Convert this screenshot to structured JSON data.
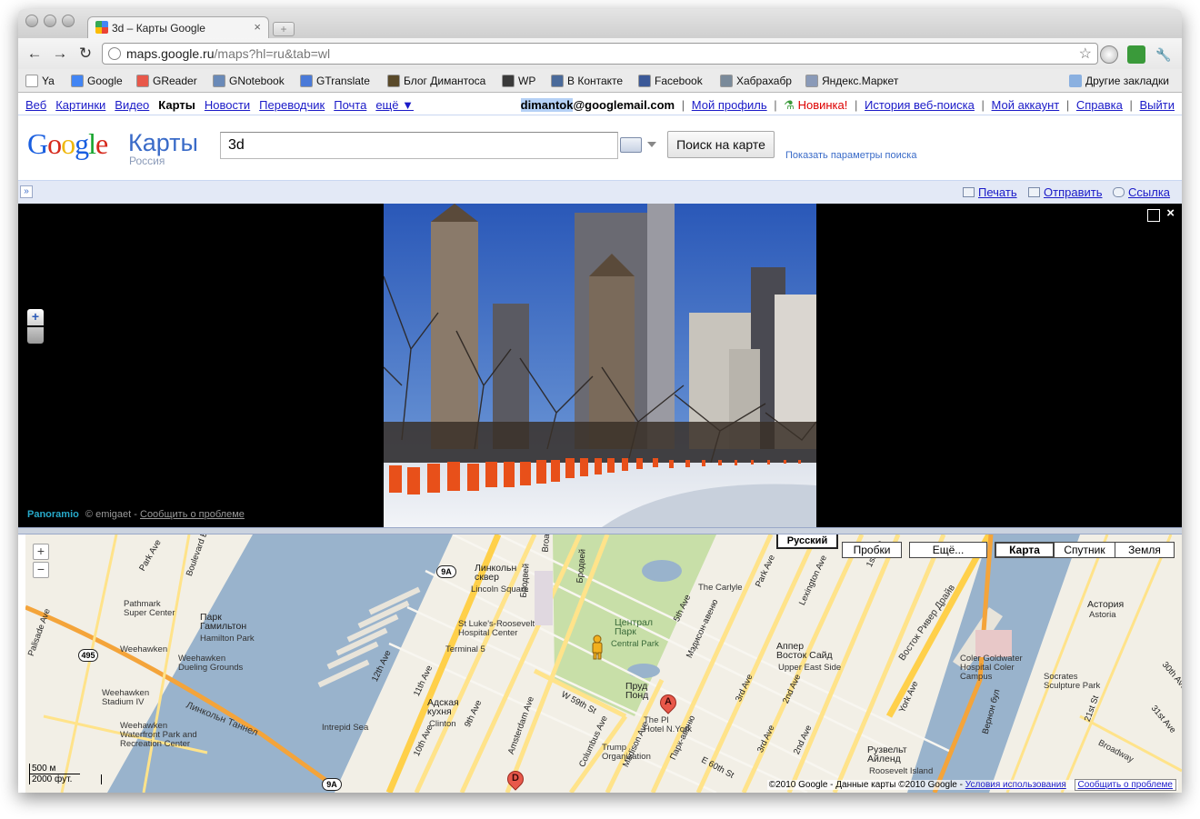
{
  "browser": {
    "tab_title": "3d – Карты Google",
    "tab_close": "×",
    "new_tab": "+",
    "url_host": "maps.google.ru",
    "url_path": "/maps?hl=ru&tab=wl",
    "back": "←",
    "forward": "→",
    "reload": "↻",
    "star": "☆",
    "wrench": "🔧"
  },
  "bookmarks": {
    "items": [
      {
        "label": "Ya",
        "color": "#ffffff"
      },
      {
        "label": "Google",
        "color": "#4285f4"
      },
      {
        "label": "GReader",
        "color": "#e8584a"
      },
      {
        "label": "GNotebook",
        "color": "#6a8ab8"
      },
      {
        "label": "GTranslate",
        "color": "#4a7ad8"
      },
      {
        "label": "Блог Димантоса",
        "color": "#5a4a2a"
      },
      {
        "label": "WP",
        "color": "#3a3a3a"
      },
      {
        "label": "В Контакте",
        "color": "#4a6a9a"
      },
      {
        "label": "Facebook",
        "color": "#3b5998"
      },
      {
        "label": "Хабрахабр",
        "color": "#7a8a9a"
      },
      {
        "label": "Яндекс.Маркет",
        "color": "#8a9ab8"
      }
    ],
    "other": "Другие закладки"
  },
  "gbar": {
    "left": [
      {
        "label": "Веб",
        "bold": false
      },
      {
        "label": "Картинки",
        "bold": false
      },
      {
        "label": "Видео",
        "bold": false
      },
      {
        "label": "Карты",
        "bold": true
      },
      {
        "label": "Новости",
        "bold": false
      },
      {
        "label": "Переводчик",
        "bold": false
      },
      {
        "label": "Почта",
        "bold": false
      },
      {
        "label": "ещё ▼",
        "bold": false
      }
    ],
    "user_highlight": "dimantok",
    "user_rest": "@googlemail.com",
    "profile": "Мой профиль",
    "new_label": "Новинка!",
    "history": "История веб-поиска",
    "account": "Мой аккаунт",
    "help": "Справка",
    "logout": "Выйти",
    "separator": "|"
  },
  "header": {
    "logo_letters": [
      "G",
      "o",
      "o",
      "g",
      "l",
      "e"
    ],
    "logo_maps": "Карты",
    "logo_country": "Россия",
    "search_value": "3d",
    "search_button": "Поиск на карте",
    "search_options": "Показать параметры поиска"
  },
  "actions": {
    "expand": "»",
    "print": "Печать",
    "send": "Отправить",
    "link": "Ссылка"
  },
  "photo": {
    "zoom_in": "+",
    "close": "×",
    "brand": "Panoramio",
    "copyright": "© emigaet -",
    "report": "Сообщить о проблеме"
  },
  "map": {
    "lang_button": "Русский",
    "traffic": "Пробки",
    "more": "Ещё...",
    "types": [
      "Карта",
      "Спутник",
      "Земля"
    ],
    "selected_type": "Карта",
    "zoom_in": "+",
    "zoom_out": "−",
    "scale_metric": "500 м",
    "scale_imperial": "2000 фут.",
    "copyright": "©2010 Google - Данные карты ©2010 Google -",
    "terms": "Условия использования",
    "report": "Сообщить о проблеме",
    "markers": [
      "A",
      "D"
    ],
    "labels": {
      "lincoln": "Линкольн\nсквер",
      "lincoln_en": "Lincoln Square",
      "central_park": "Централ\nПарк",
      "central_park_en": "Central Park",
      "pond": "Пруд\nПонд",
      "upper": "Аппер\nВосток Сайд",
      "upper_en": "Upper East Side",
      "astoria": "Астория",
      "astoria_en": "Astoria",
      "hell": "Адская\nкухня",
      "hell_en": "Clinton",
      "roosevelt": "Рузвельт\nАйленд",
      "roosevelt_en": "Roosevelt Island",
      "hamilton": "Парк\nГамильтон",
      "hamilton_en": "Hamilton Park",
      "weehawken": "Weehawken",
      "weehawken_dueling": "Weehawken\nDueling Grounds",
      "weehawken_stadium": "Weehawken\nStadium IV",
      "weehawken_waterfront": "Weehawken\nWaterfront Park and\nRecreation Center",
      "pathmark": "Pathmark\nSuper Center",
      "tunnel": "Линкольн Таннел",
      "intrepid": "Intrepid Sea",
      "terminal": "Terminal 5",
      "stlukes": "St Luke's-Roosevelt\nHospital Center",
      "trump": "Trump\nOrganization",
      "plaza": "The Pl\nHotel N.York",
      "carlyle": "The Carlyle",
      "coler": "Coler Goldwater\nHospital Coler\nCampus",
      "socrates": "Socrates\nSculpture Park",
      "vostok": "Восток Ривер Драйв",
      "broadway": "Broadway"
    },
    "streets": [
      "Park Ave",
      "Boulevard E",
      "Palisade Ave",
      "12th Ave",
      "11th Ave",
      "10th Ave",
      "9th Ave",
      "W 59th St",
      "5th Ave",
      "Мэдисон-авеню",
      "Park Ave",
      "Lexington Ave",
      "3rd Ave",
      "2nd Ave",
      "1st Ave",
      "York Ave",
      "Парк-авеню",
      "Madison Ave",
      "E 60th St",
      "3rd Ave",
      "2nd Ave",
      "21st St",
      "31st Ave",
      "30th Ave",
      "Вернон бул",
      "Broadway",
      "Бродвей",
      "Columbus Ave",
      "Amsterdam Ave",
      "Бродвей"
    ],
    "highways": [
      "495",
      "9A",
      "9A"
    ]
  }
}
